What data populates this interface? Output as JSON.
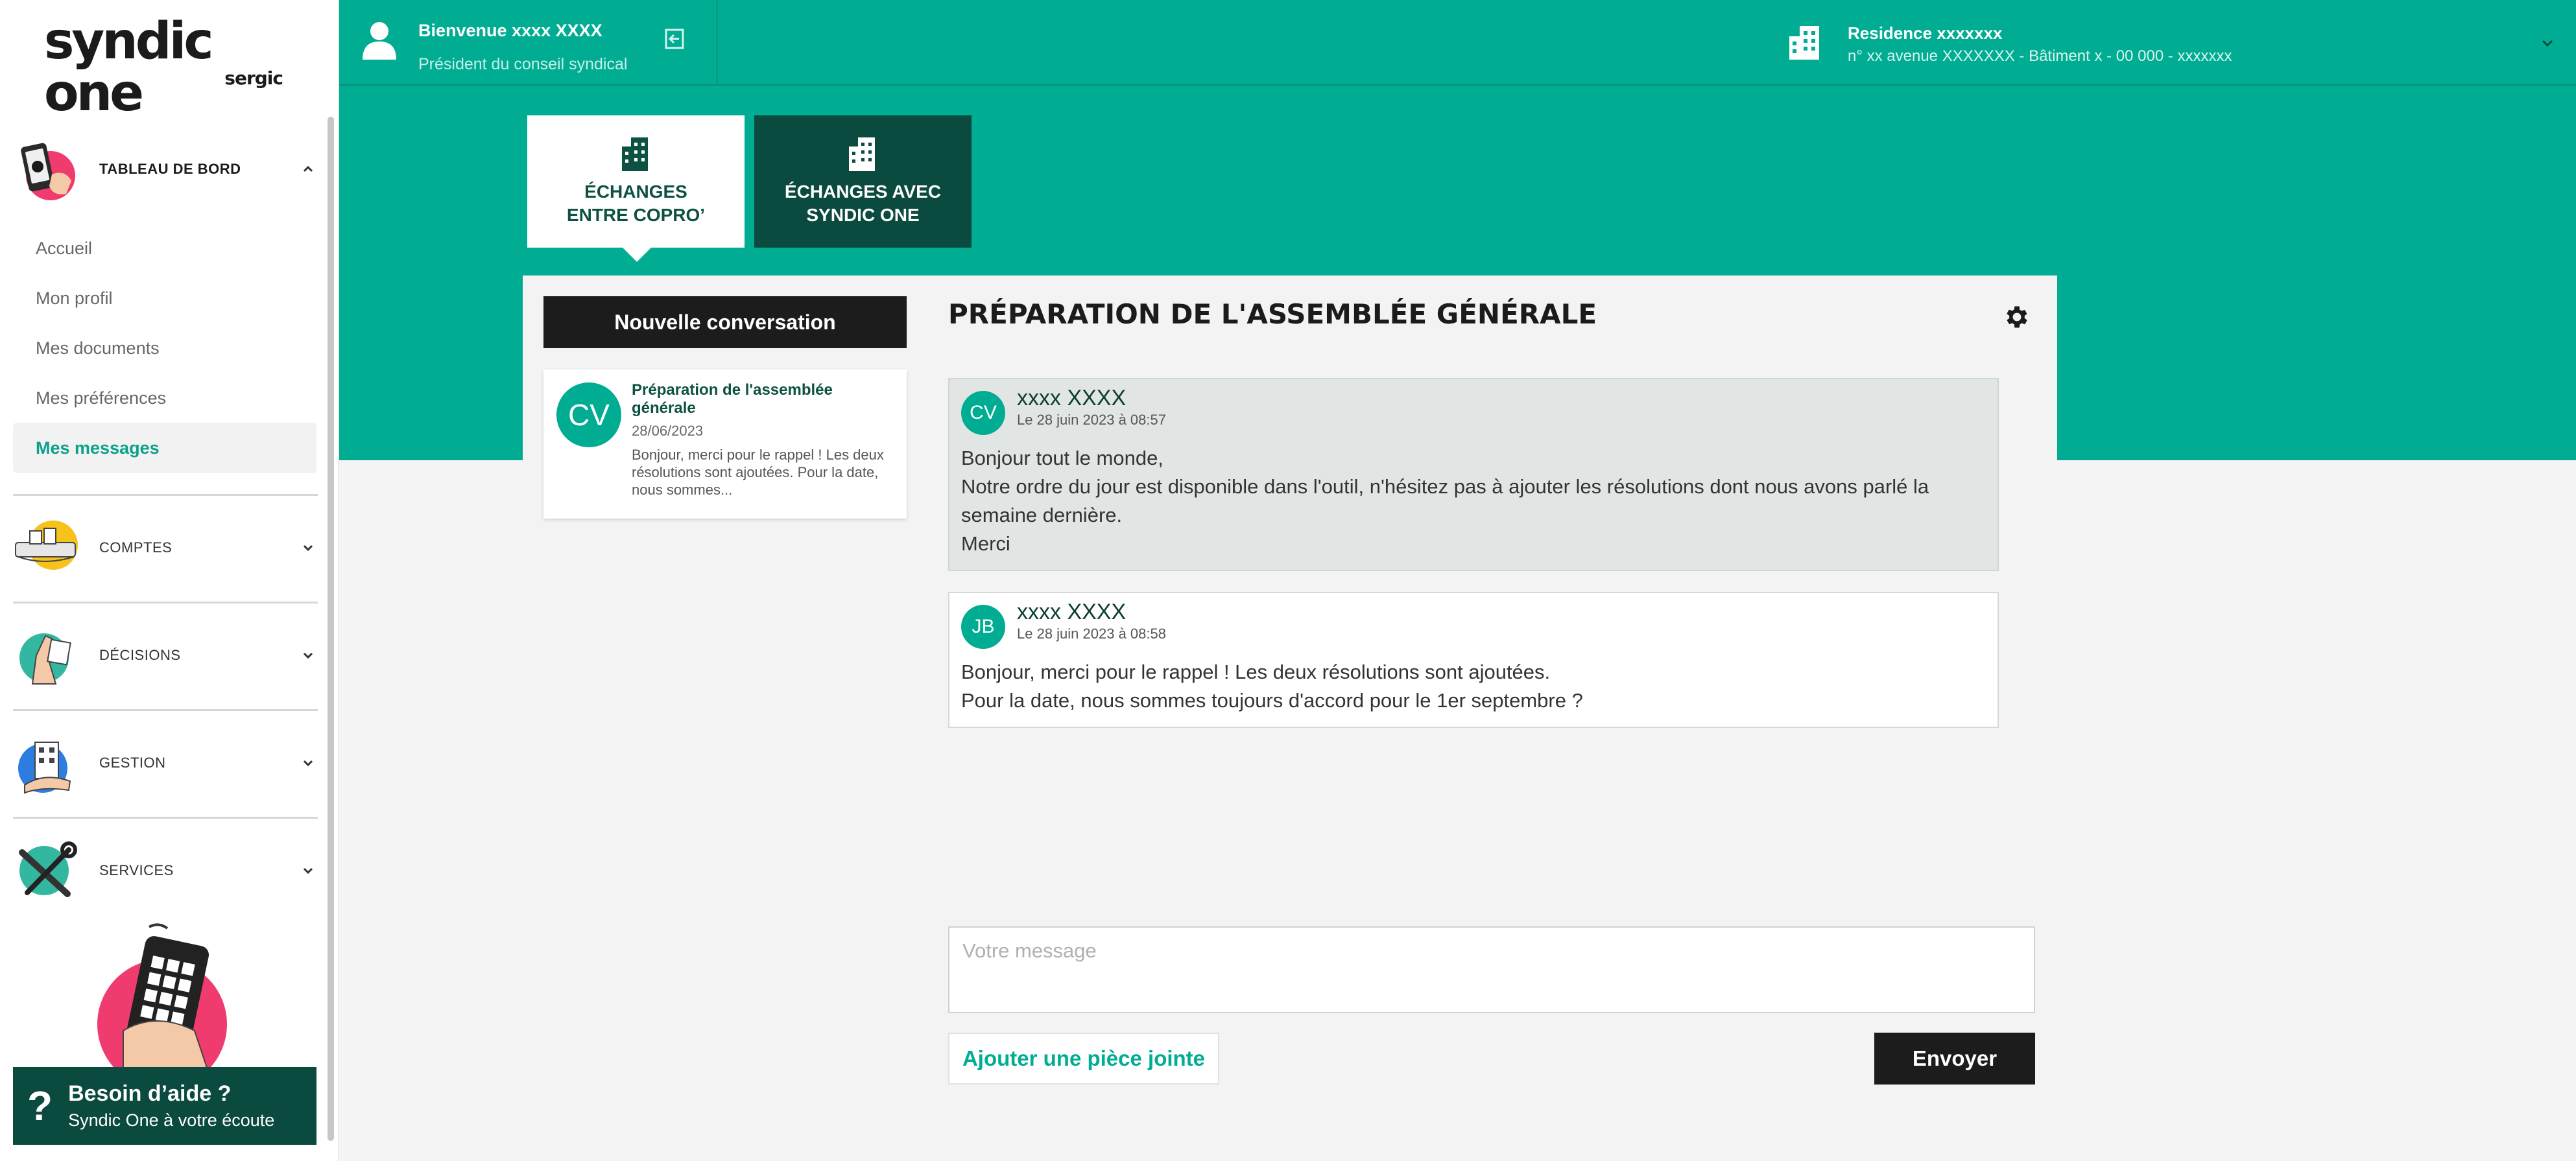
{
  "brand": {
    "name": "syndic one",
    "sub": "sergic"
  },
  "colors": {
    "accent": "#00ad93",
    "dark_green": "#0b4a3f",
    "pink": "#ef3b6e",
    "dark": "#1c1c1c"
  },
  "sidebar": {
    "sections": [
      {
        "label": "TABLEAU DE BORD",
        "icon": "phone-illustration",
        "expanded": true
      },
      {
        "label": "COMPTES",
        "icon": "wallet-illustration",
        "expanded": false
      },
      {
        "label": "DÉCISIONS",
        "icon": "vote-illustration",
        "expanded": false
      },
      {
        "label": "GESTION",
        "icon": "building-hand-illustration",
        "expanded": false
      },
      {
        "label": "SERVICES",
        "icon": "tools-illustration",
        "expanded": false
      }
    ],
    "items": [
      "Accueil",
      "Mon profil",
      "Mes documents",
      "Mes préférences",
      "Mes messages"
    ],
    "active_item": "Mes messages",
    "help": {
      "title": "Besoin d’aide ?",
      "subtitle": "Syndic One à votre écoute",
      "icon": "question-icon"
    }
  },
  "topbar": {
    "user_name": "Bienvenue xxxx XXXX",
    "user_role": "Président du conseil syndical",
    "residence_name": "Residence xxxxxxx",
    "residence_address": "n° xx avenue XXXXXXX - Bâtiment x - 00 000 - xxxxxxx"
  },
  "tabs": [
    {
      "line1": "ÉCHANGES",
      "line2": "ENTRE COPRO’",
      "active": true,
      "icon": "buildings-icon"
    },
    {
      "line1": "ÉCHANGES AVEC",
      "line2": "SYNDIC ONE",
      "active": false,
      "icon": "buildings-icon"
    }
  ],
  "conversations": {
    "new_button": "Nouvelle conversation",
    "list": [
      {
        "initials": "CV",
        "title": "Préparation de l'assemblée générale",
        "date": "28/06/2023",
        "preview": "Bonjour, merci pour le rappel ! Les deux résolutions sont ajoutées. Pour la date, nous sommes..."
      }
    ]
  },
  "thread": {
    "title": "PRÉPARATION DE L'ASSEMBLÉE GÉNÉRALE",
    "messages": [
      {
        "initials": "CV",
        "sender": "xxxx XXXX",
        "time": "Le 28 juin 2023 à 08:57",
        "lines": [
          "Bonjour tout le monde,",
          "Notre ordre du jour est disponible dans l'outil, n'hésitez pas à ajouter les résolutions dont nous avons parlé la semaine dernière.",
          "Merci"
        ]
      },
      {
        "initials": "JB",
        "sender": "xxxx XXXX",
        "time": "Le 28 juin 2023 à 08:58",
        "lines": [
          "Bonjour, merci pour le rappel ! Les deux résolutions sont ajoutées.",
          "Pour la date, nous sommes toujours d'accord pour le 1er septembre ?"
        ]
      }
    ],
    "composer_placeholder": "Votre message",
    "attach_label": "Ajouter une pièce jointe",
    "send_label": "Envoyer"
  }
}
